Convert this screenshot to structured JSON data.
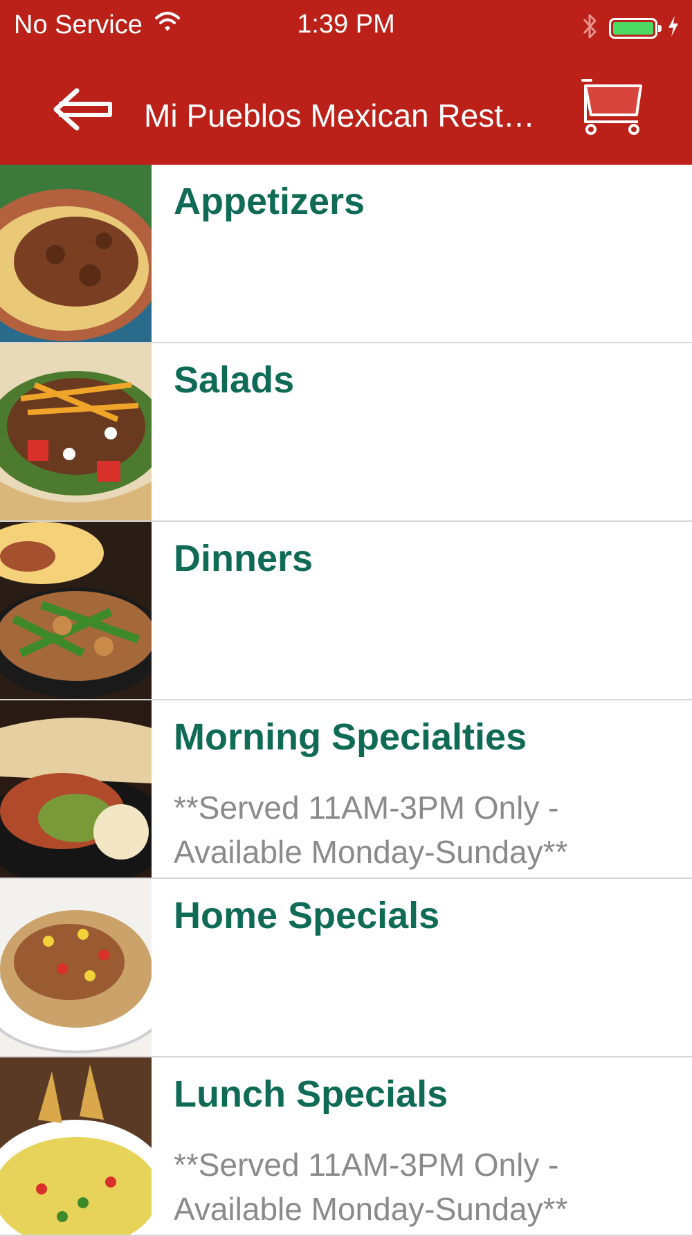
{
  "status_bar": {
    "carrier": "No Service",
    "time": "1:39 PM",
    "battery_color": "#4cd964"
  },
  "nav_bar": {
    "title": "Mi Pueblos Mexican Restaurant",
    "back_icon": "arrow-left-icon",
    "cart_icon": "shopping-cart-icon",
    "background_color": "#bb2118"
  },
  "menu": {
    "title_color": "#0f6b55",
    "items": [
      {
        "title": "Appetizers",
        "description": ""
      },
      {
        "title": "Salads",
        "description": ""
      },
      {
        "title": "Dinners",
        "description": ""
      },
      {
        "title": "Morning Specialties",
        "description": "**Served 11AM-3PM Only - Available Monday-Sunday**"
      },
      {
        "title": "Home Specials",
        "description": ""
      },
      {
        "title": "Lunch Specials",
        "description": "**Served 11AM-3PM Only - Available Monday-Sunday**"
      }
    ]
  }
}
